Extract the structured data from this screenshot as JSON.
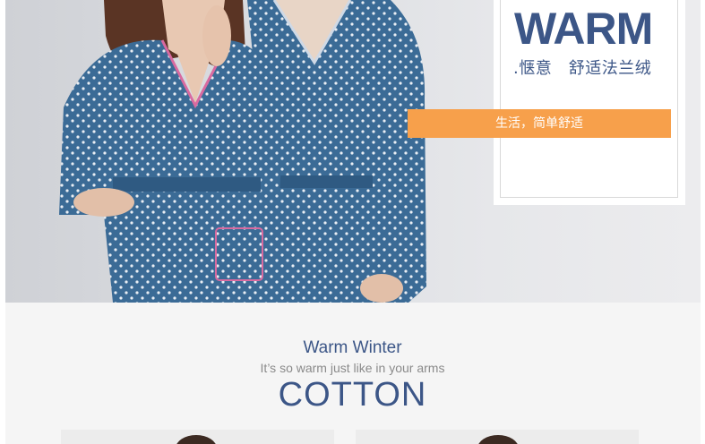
{
  "hero": {
    "brand_word": "WARM",
    "tagline": ".惬意　舒适法兰绒",
    "slogan": "生活，简单舒适",
    "colors": {
      "navy": "#3c5687",
      "orange": "#f7a04b",
      "robe": "#3b6b96"
    }
  },
  "section": {
    "title": "Warm Winter",
    "subtitle": "It’s so warm just like in your arms",
    "heading": "COTTON"
  }
}
